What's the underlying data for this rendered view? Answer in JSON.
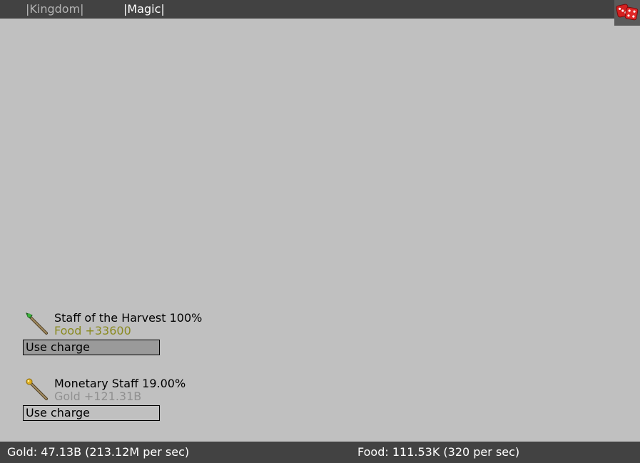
{
  "tabs": [
    {
      "label": "|Kingdom|",
      "active": false
    },
    {
      "label": "|Magic|",
      "active": true
    }
  ],
  "dice_button": {
    "icon": "dice-icon"
  },
  "staffs": [
    {
      "name": "Staff of the Harvest 100%",
      "effect": "Food +33600",
      "button_label": "Use charge",
      "icon": "harvest-staff-icon"
    },
    {
      "name": "Monetary Staff 19.00%",
      "effect": "Gold +121.31B",
      "button_label": "Use charge",
      "icon": "monetary-staff-icon"
    }
  ],
  "status": {
    "gold": "Gold: 47.13B (213.12M per sec)",
    "food": "Food: 111.53K (320 per sec)"
  },
  "colors": {
    "background": "#c0c0c0",
    "bar": "#424242",
    "food_text": "#8a8a20",
    "gold_text_dim": "#909090",
    "dice_red": "#d42020"
  }
}
